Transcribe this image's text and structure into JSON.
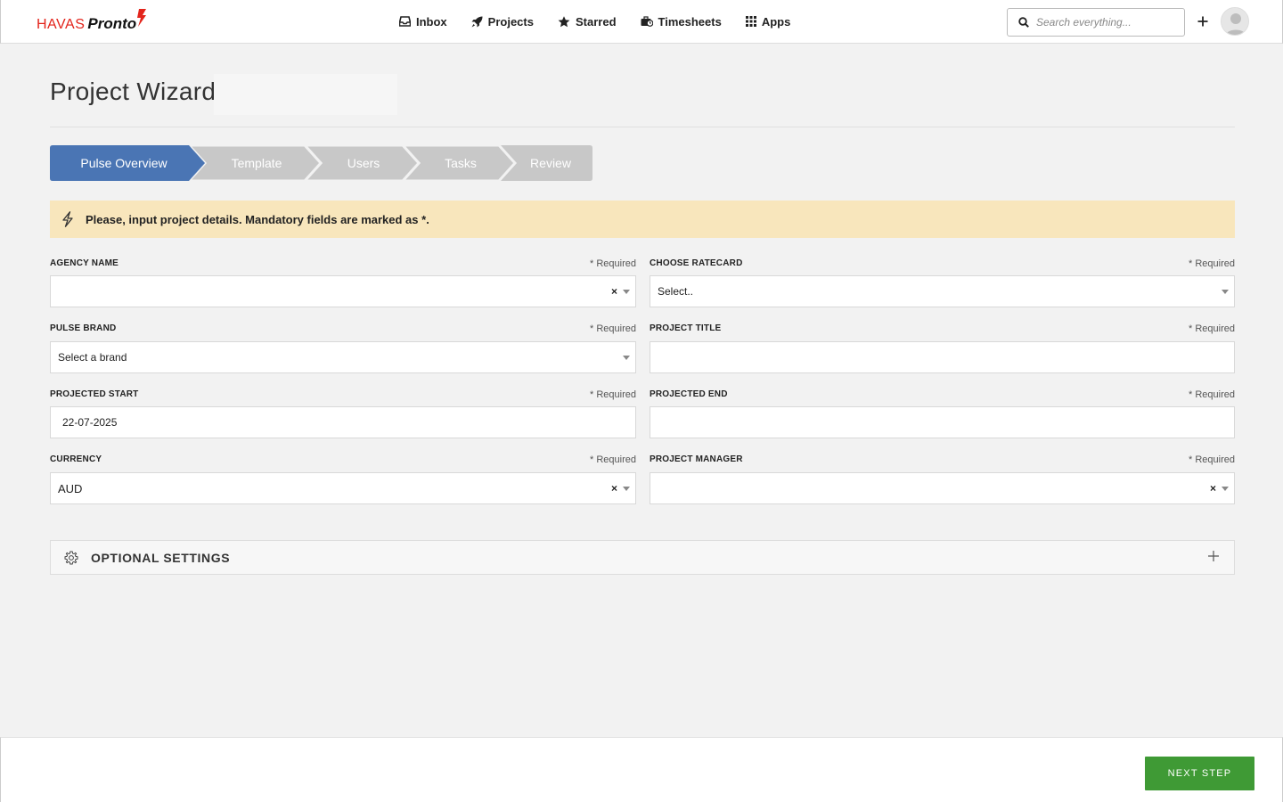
{
  "brand": {
    "havas": "HAVAS",
    "pronto": "Pronto",
    "accent": "#e3241b"
  },
  "nav": [
    {
      "label": "Inbox",
      "icon": "inbox-icon"
    },
    {
      "label": "Projects",
      "icon": "rocket-icon"
    },
    {
      "label": "Starred",
      "icon": "star-icon"
    },
    {
      "label": "Timesheets",
      "icon": "briefcase-clock-icon"
    },
    {
      "label": "Apps",
      "icon": "grid-icon"
    }
  ],
  "search": {
    "placeholder": "Search everything..."
  },
  "page": {
    "title": "Project Wizard"
  },
  "steps": [
    {
      "label": "Pulse Overview",
      "active": true
    },
    {
      "label": "Template",
      "active": false
    },
    {
      "label": "Users",
      "active": false
    },
    {
      "label": "Tasks",
      "active": false
    },
    {
      "label": "Review",
      "active": false
    }
  ],
  "notice": {
    "text": "Please, input project details. Mandatory fields are marked as *."
  },
  "form": {
    "required_text": "* Required",
    "agency_name": {
      "label": "AGENCY NAME",
      "value": ""
    },
    "ratecard": {
      "label": "CHOOSE RATECARD",
      "value": "Select.."
    },
    "pulse_brand": {
      "label": "PULSE BRAND",
      "value": "Select a brand"
    },
    "project_title": {
      "label": "PROJECT TITLE",
      "value": ""
    },
    "projected_start": {
      "label": "PROJECTED START",
      "value": "22-07-2025"
    },
    "projected_end": {
      "label": "PROJECTED END",
      "value": ""
    },
    "currency": {
      "label": "CURRENCY",
      "value": "AUD"
    },
    "project_manager": {
      "label": "PROJECT MANAGER",
      "value": ""
    }
  },
  "optional_settings": {
    "label": "OPTIONAL SETTINGS"
  },
  "footer": {
    "next_label": "NEXT STEP"
  },
  "colors": {
    "step_active": "#4a75b4",
    "step_inactive": "#c8c8c8",
    "notice_bg": "#f8e6bc",
    "next_button": "#3f9a35"
  }
}
